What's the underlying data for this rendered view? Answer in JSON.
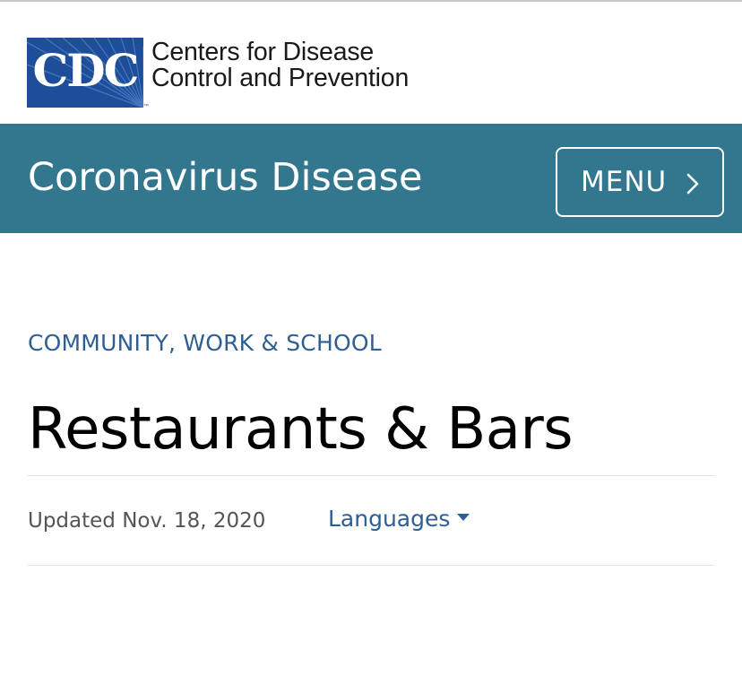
{
  "header": {
    "logo_text": "CDC",
    "org_name_line1": "Centers for Disease",
    "org_name_line2": "Control and Prevention"
  },
  "banner": {
    "title": "Coronavirus Disease",
    "menu_label": "MENU",
    "background_color": "#33778e"
  },
  "article": {
    "eyebrow": "COMMUNITY, WORK & SCHOOL",
    "title": "Restaurants & Bars",
    "updated": "Updated Nov. 18, 2020",
    "languages_label": "Languages"
  },
  "colors": {
    "brand_blue": "#1e4d9a",
    "link_blue": "#2d5e94",
    "banner_teal": "#33778e"
  },
  "icons": {
    "menu_chevron": "chevron-right-icon",
    "languages_caret": "caret-down-icon"
  }
}
